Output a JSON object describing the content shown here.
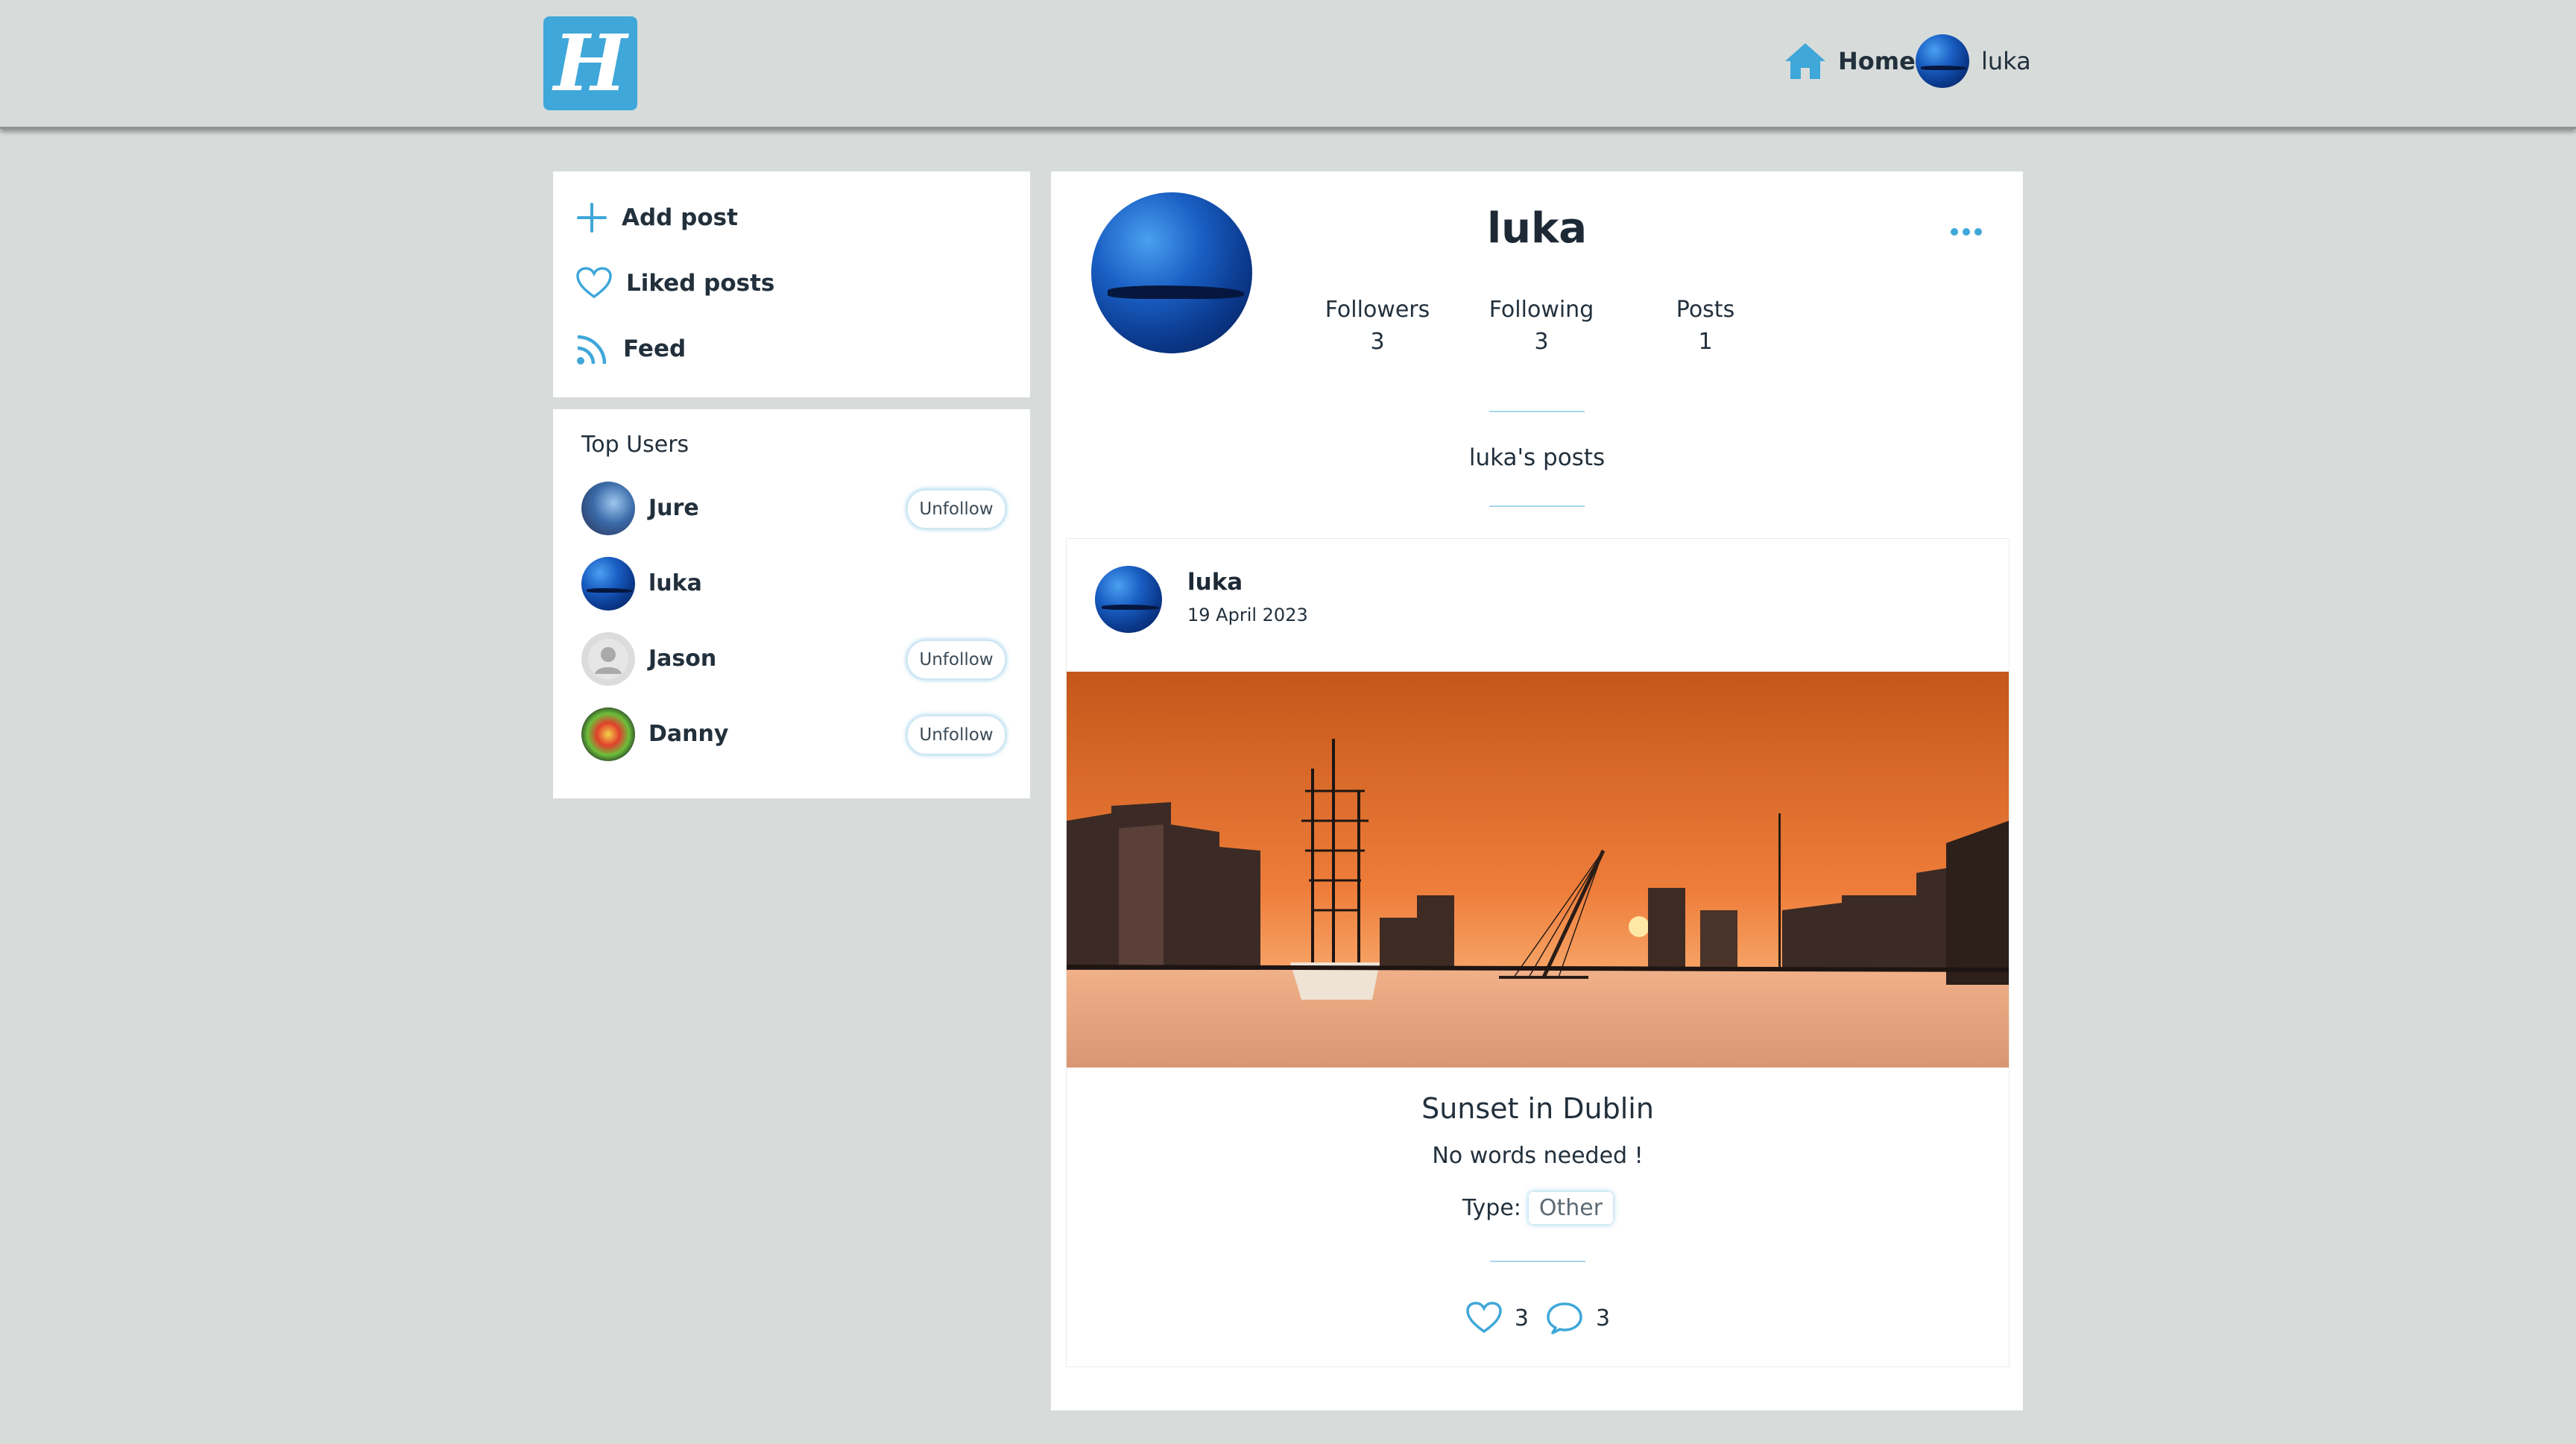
{
  "brand": {
    "logo_letter": "H",
    "accent": "#3fa7d9"
  },
  "topnav": {
    "home_label": "Home",
    "user_label": "luka"
  },
  "sidebar": {
    "menu": [
      {
        "label": "Add post",
        "icon": "plus-icon"
      },
      {
        "label": "Liked posts",
        "icon": "heart-icon"
      },
      {
        "label": "Feed",
        "icon": "rss-icon"
      }
    ],
    "top_users_title": "Top Users",
    "top_users": [
      {
        "name": "Jure",
        "action": "Unfollow"
      },
      {
        "name": "luka",
        "action": ""
      },
      {
        "name": "Jason",
        "action": "Unfollow"
      },
      {
        "name": "Danny",
        "action": "Unfollow"
      }
    ]
  },
  "profile": {
    "name": "luka",
    "stats": [
      {
        "label": "Followers",
        "value": "3"
      },
      {
        "label": "Following",
        "value": "3"
      },
      {
        "label": "Posts",
        "value": "1"
      }
    ],
    "posts_heading": "luka's posts"
  },
  "post": {
    "author": "luka",
    "date": "19 April 2023",
    "title": "Sunset in Dublin",
    "description": "No words needed !",
    "type_label": "Type:",
    "type_value": "Other",
    "likes": "3",
    "comments": "3"
  }
}
